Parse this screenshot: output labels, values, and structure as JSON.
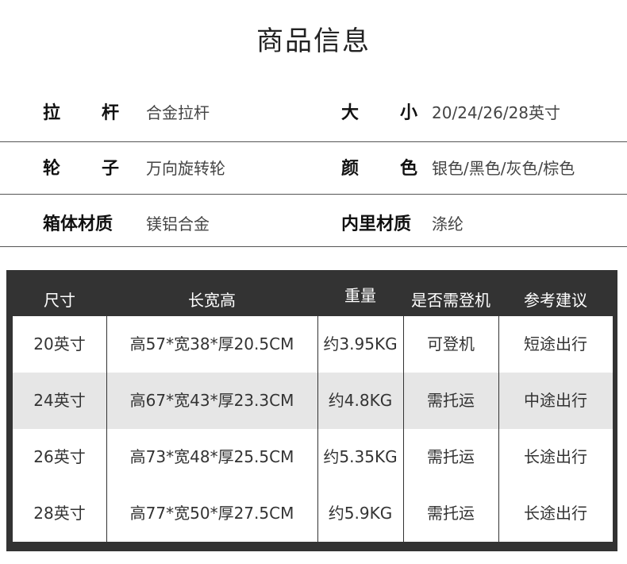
{
  "title": "商品信息",
  "specs": [
    {
      "left": {
        "label_a": "拉",
        "label_b": "杆",
        "value": "合金拉杆"
      },
      "right": {
        "label_a": "大",
        "label_b": "小",
        "value": "20/24/26/28英寸"
      }
    },
    {
      "left": {
        "label_a": "轮",
        "label_b": "子",
        "value": "万向旋转轮"
      },
      "right": {
        "label_a": "颜",
        "label_b": "色",
        "value": "银色/黑色/灰色/棕色"
      }
    },
    {
      "left": {
        "label": "箱体材质",
        "value": "镁铝合金"
      },
      "right": {
        "label": "内里材质",
        "value": "涤纶"
      }
    }
  ],
  "table": {
    "headers": [
      "尺寸",
      "长宽高",
      "重量",
      "是否需登机",
      "参考建议"
    ],
    "rows": [
      [
        "20英寸",
        "高57*宽38*厚20.5CM",
        "约3.95KG",
        "可登机",
        "短途出行"
      ],
      [
        "24英寸",
        "高67*宽43*厚23.3CM",
        "约4.8KG",
        "需托运",
        "中途出行"
      ],
      [
        "26英寸",
        "高73*宽48*厚25.5CM",
        "约5.35KG",
        "需托运",
        "长途出行"
      ],
      [
        "28英寸",
        "高77*宽50*厚27.5CM",
        "约5.9KG",
        "需托运",
        "长途出行"
      ]
    ]
  }
}
